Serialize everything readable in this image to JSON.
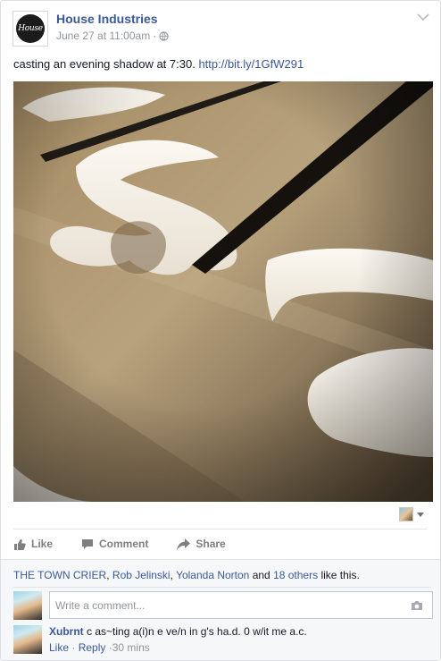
{
  "post": {
    "page_name": "House Industries",
    "avatar_text": "House",
    "timestamp": "June 27 at 11:00am",
    "meta_dot": "·",
    "text": "casting an evening shadow at 7:30.",
    "link": "http://bit.ly/1GfW291"
  },
  "actions": {
    "like": "Like",
    "comment": "Comment",
    "share": "Share"
  },
  "likes": {
    "names": [
      "THE TOWN CRIER",
      "Rob Jelinski",
      "Yolanda Norton"
    ],
    "sep1": ", ",
    "sep2": ", ",
    "and": " and ",
    "others": "18 others",
    "suffix": " like this."
  },
  "compose": {
    "placeholder": "Write a comment..."
  },
  "comment": {
    "author": "Xubrnt",
    "text": "c as~ting a(i)n e ve/n in g's ha.d. 0 w/it me a.c.",
    "like": "Like",
    "reply": "Reply",
    "dot1": "·",
    "dot2": "·",
    "time": "30 mins"
  },
  "colors": {
    "link_blue": "#3b5998",
    "panel_bg": "#f6f7f9",
    "muted": "#90949c"
  },
  "icons": {
    "chevron": "chevron-down-icon",
    "globe": "globe-icon",
    "thumb": "thumbs-up-icon",
    "comment": "speech-bubble-icon",
    "share": "share-arrow-icon",
    "camera": "camera-icon"
  }
}
